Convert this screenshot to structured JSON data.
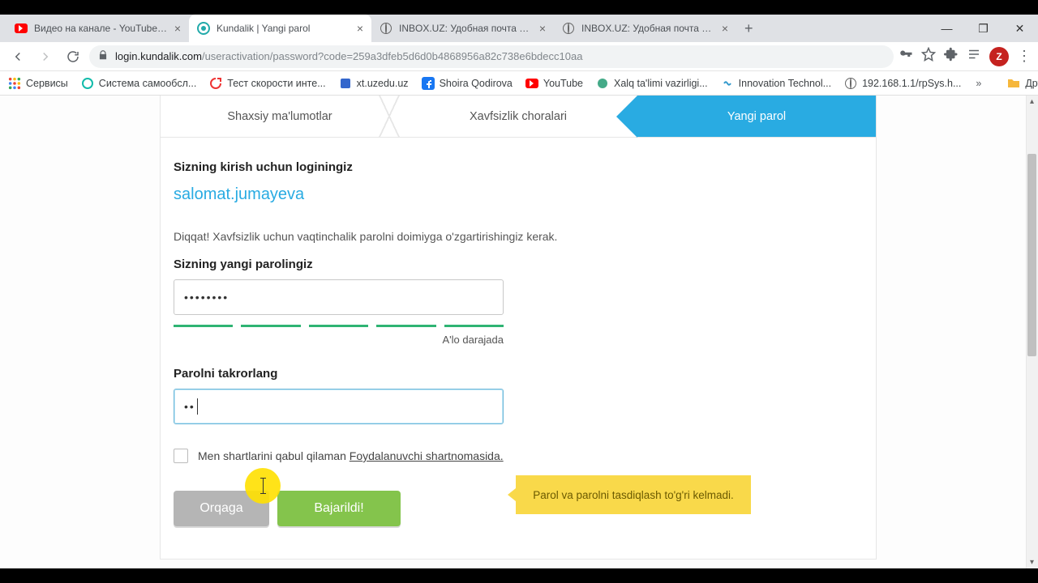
{
  "tabs": [
    {
      "title": "Видео на канале - YouTube Stud"
    },
    {
      "title": "Kundalik | Yangi parol"
    },
    {
      "title": "INBOX.UZ: Удобная почта zubay"
    },
    {
      "title": "INBOX.UZ: Удобная почта zubay"
    }
  ],
  "url_host": "login.kundalik.com",
  "url_path": "/useractivation/password?code=259a3dfeb5d6d0b4868956a82c738e6bdecc10aa",
  "avatar_letter": "Z",
  "bookmarks": [
    {
      "label": "Сервисы"
    },
    {
      "label": "Система самообсл..."
    },
    {
      "label": "Тест скорости инте..."
    },
    {
      "label": "xt.uzedu.uz"
    },
    {
      "label": "Shoira Qodirova"
    },
    {
      "label": "YouTube"
    },
    {
      "label": "Xalq ta'limi vazirligi..."
    },
    {
      "label": "Innovation Technol..."
    },
    {
      "label": "192.168.1.1/rpSys.h..."
    }
  ],
  "bk_overflow": "»",
  "bk_other": "Другие закладки",
  "steps": {
    "s1": "Shaxsiy ma'lumotlar",
    "s2": "Xavfsizlik choralari",
    "s3": "Yangi parol"
  },
  "login_label": "Sizning kirish uchun loginingiz",
  "login_value": "salomat.jumayeva",
  "notice": "Diqqat! Xavfsizlik uchun vaqtinchalik parolni doimiyga o'zgartirishingiz kerak.",
  "new_pw_label": "Sizning yangi parolingiz",
  "new_pw_value": "••••••••",
  "strength_label": "A'lo darajada",
  "repeat_label": "Parolni takrorlang",
  "repeat_value": "••",
  "tooltip": "Parol va parolni tasdiqlash to'g'ri kelmadi.",
  "terms_text": "Men shartlarini qabul qilaman ",
  "terms_link": "Foydalanuvchi shartnomasida.",
  "btn_back": "Orqaga",
  "btn_done": "Bajarildi!"
}
